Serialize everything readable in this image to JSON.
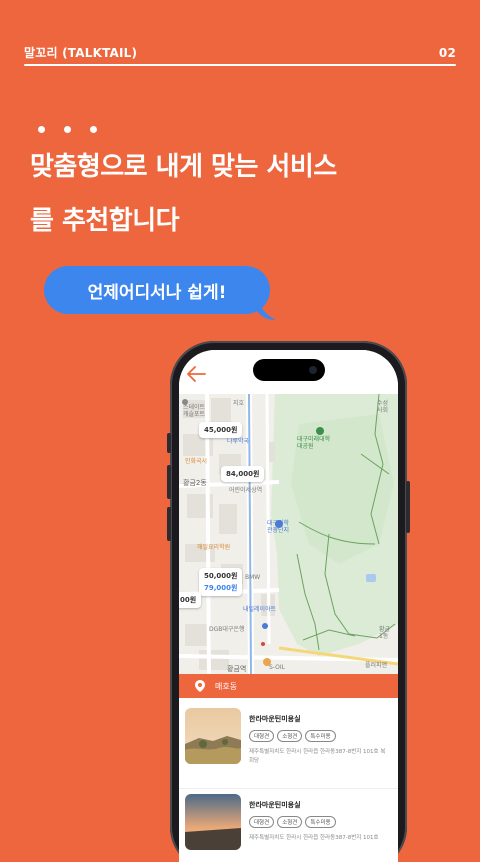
{
  "topbar": {
    "brand": "말꼬리 (TALKTAIL)",
    "page_number": "02"
  },
  "headline": {
    "line1": "맞춤형으로 내게 맞는 서비스",
    "line2": "를 추천합니다"
  },
  "bubble": {
    "text": "언제어디서나 쉽게!"
  },
  "colors": {
    "background": "#EE663E",
    "bubble": "#3D86EE",
    "park": "#C9E3C4"
  },
  "app": {
    "back_icon": "arrow-left-icon",
    "map": {
      "price_tags": [
        "45,000원",
        "84,000원",
        "50,000원",
        "79,000원",
        "00원"
      ],
      "labels": {
        "jiho": "지호",
        "naru": "나루약국",
        "inhwa": "인화국시",
        "hwanggeum2": "황금2동",
        "children_world": "어린이세상역",
        "daegu_science": "대구과학\n관광단지",
        "daegu_univ": "대구미래대학\n대공원",
        "hanil": "해일요리학원",
        "bmw": "BMW",
        "dgb": "DGB대구은행",
        "hwanggeum_station": "황금역",
        "soil": "S-OIL",
        "tomorrow": "내일레이아트",
        "soseong": "수성\n사회",
        "hwang": "황금\n1동",
        "dae": "플러피앤",
        "hotel": "스테이트\n캐슬포트"
      }
    },
    "location": {
      "icon": "map-pin-icon",
      "label": "매호동"
    },
    "listings": [
      {
        "title": "한라마운틴미용실",
        "tags": [
          "대형견",
          "소형견",
          "특수미용"
        ],
        "address": "제주특별자치도 한라시 한라읍 한라동387-8번지 101호 복회당"
      },
      {
        "title": "한라마운틴미용실",
        "tags": [
          "대형견",
          "소형견",
          "특수미용"
        ],
        "address": "제주특별자치도 한라시 한라읍 한라동387-8번지 101호"
      }
    ]
  }
}
